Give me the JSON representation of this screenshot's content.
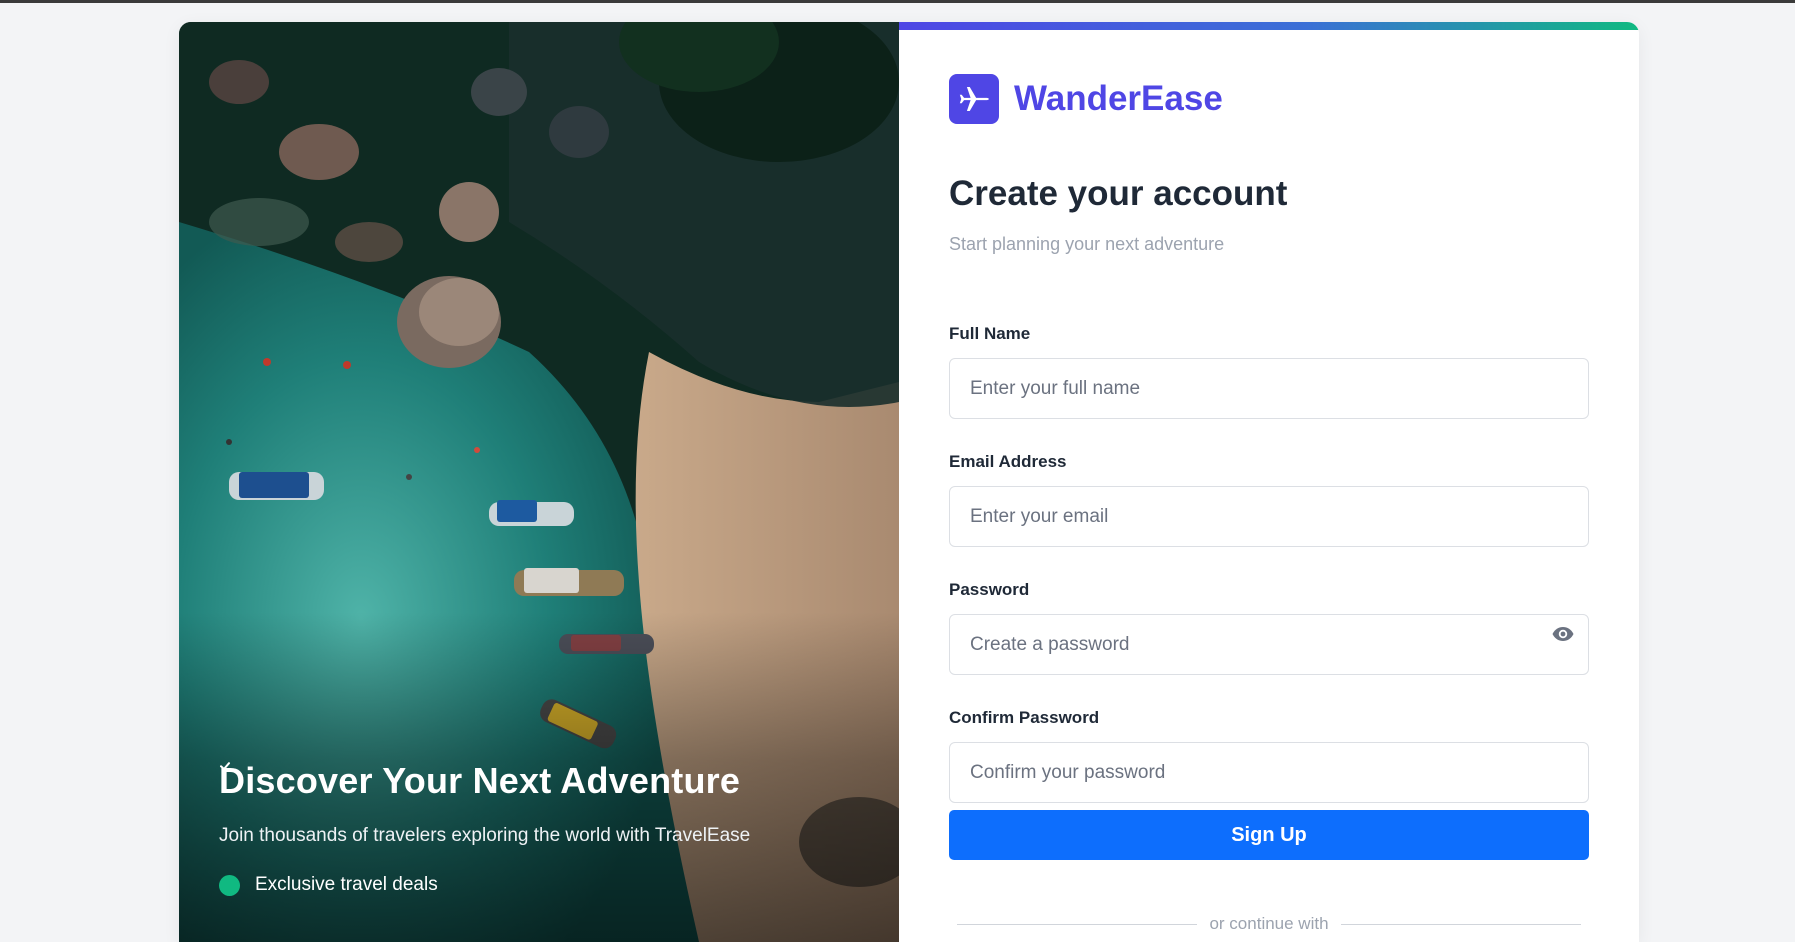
{
  "hero": {
    "title": "Discover Your Next Adventure",
    "subtitle": "Join thousands of travelers exploring the world with TravelEase",
    "features": [
      "Exclusive travel deals"
    ]
  },
  "brand": {
    "name": "WanderEase",
    "logo_icon": "airplane-icon",
    "color": "#4f46e5"
  },
  "form": {
    "title": "Create your account",
    "subtitle": "Start planning your next adventure",
    "fields": [
      {
        "label": "Full Name",
        "placeholder": "Enter your full name",
        "type": "text"
      },
      {
        "label": "Email Address",
        "placeholder": "Enter your email",
        "type": "email"
      },
      {
        "label": "Password",
        "placeholder": "Create a password",
        "type": "password"
      },
      {
        "label": "Confirm Password",
        "placeholder": "Confirm your password",
        "type": "password"
      }
    ],
    "submit_label": "Sign Up",
    "divider_text": "or continue with",
    "submit_color": "#0d6efd",
    "accent_gradient": [
      "#4f46e5",
      "#10b981"
    ]
  }
}
